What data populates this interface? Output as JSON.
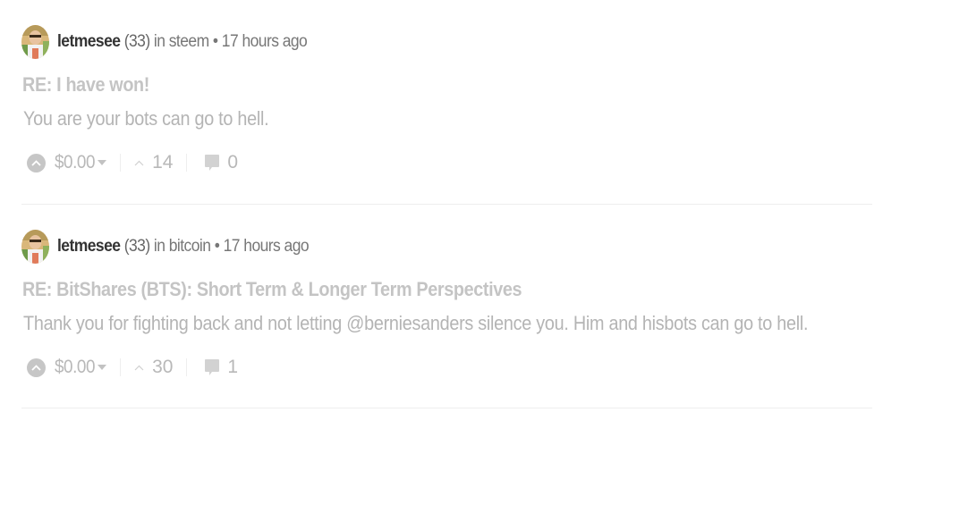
{
  "posts": [
    {
      "author": "letmesee",
      "reputation": "(33)",
      "in_label": "in",
      "community": "steem",
      "separator": "•",
      "time": "17 hours ago",
      "title": "RE: I have won!",
      "body": "You are your bots can go to hell.",
      "payout": "$0.00",
      "votes": "14",
      "replies": "0"
    },
    {
      "author": "letmesee",
      "reputation": "(33)",
      "in_label": "in",
      "community": "bitcoin",
      "separator": "•",
      "time": "17 hours ago",
      "title": "RE: BitShares (BTS): Short Term & Longer Term Perspectives",
      "body": "Thank you for fighting back and not letting @berniesanders silence you. Him and hisbots can go to hell.",
      "payout": "$0.00",
      "votes": "30",
      "replies": "1"
    }
  ],
  "icons": {
    "upvote": "upvote-icon",
    "payout_dropdown": "chevron-down-icon",
    "votes": "chevron-up-icon",
    "replies": "comment-icon"
  },
  "colors": {
    "author": "#333333",
    "meta": "#777777",
    "title": "#c4c4c4",
    "body": "#b4b4b4",
    "footer": "#b8b8b8",
    "divider": "#eeeeee"
  }
}
